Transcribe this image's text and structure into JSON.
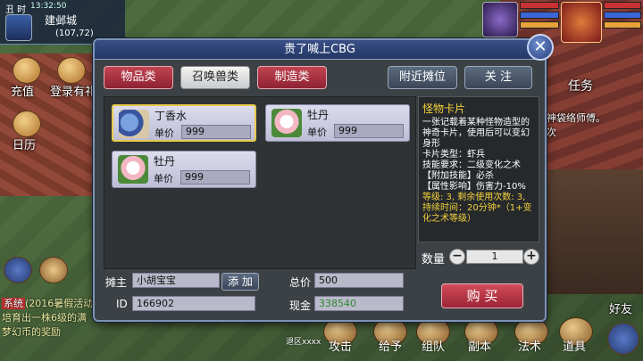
{
  "hud": {
    "time_prefix": "丑 时",
    "clock": "13:32:50",
    "map_name": "建邺城",
    "coords": "(107,72)",
    "side_left": [
      {
        "label": "充值",
        "icon": "coin-icon"
      },
      {
        "label": "登录有礼",
        "icon": "gift-icon"
      },
      {
        "label": "日历",
        "icon": "calendar-icon"
      }
    ],
    "right_task": "任务",
    "right_npc": "神袋络师傅。",
    "right_npc2": "次",
    "chat": [
      {
        "tag": "系统",
        "text": "(2016暑假活动"
      },
      {
        "text": "培育出一株6级的满"
      },
      {
        "text": "梦幻币的奖励"
      }
    ],
    "bottom_buttons": [
      "攻击",
      "给予",
      "组队",
      "副本",
      "法术",
      "道具"
    ],
    "friend": "好友",
    "ground_text": "退区xxxx"
  },
  "panel": {
    "title": "贵了喊上CBG",
    "close": "✕"
  },
  "tabs": [
    {
      "label": "物品类",
      "state": "active"
    },
    {
      "label": "召唤兽类",
      "state": "normal"
    },
    {
      "label": "制造类",
      "state": "red"
    }
  ],
  "top_buttons": {
    "nearby": "附近摊位",
    "follow": "关 注"
  },
  "items": [
    {
      "name": "丁香水",
      "price_label": "单价",
      "price": "999",
      "icon": "snail-potion-icon",
      "selected": true
    },
    {
      "name": "牡丹",
      "price_label": "单价",
      "price": "999",
      "icon": "peony-flower-icon",
      "selected": false
    },
    {
      "name": "牡丹",
      "price_label": "单价",
      "price": "999",
      "icon": "peony-flower-icon",
      "selected": false
    }
  ],
  "detail": {
    "title": "怪物卡片",
    "lines_white": [
      "一张记载着某种怪物造型的神奇卡片，使用后可以变幻身形",
      "卡片类型：虾兵",
      "技能要求：二级变化之术",
      "【附加技能】必杀",
      "【属性影响】伤害力-10%"
    ],
    "lines_yellow": [
      "等级: 3, 剩余使用次数: 3, 持续时间：20分钟*（1+变化之术等级）"
    ]
  },
  "quantity": {
    "label": "数量",
    "value": "1",
    "minus": "−",
    "plus": "+"
  },
  "buy_label": "购 买",
  "stall": {
    "owner_label": "摊主",
    "owner": "小胡宝宝",
    "add_label": "添 加",
    "id_label": "ID",
    "id": "166902",
    "total_label": "总价",
    "total": "500",
    "cash_label": "现金",
    "cash": "338540"
  },
  "colors": {
    "accent_red": "#c14452",
    "panel_border": "#7d93b6",
    "highlight_yellow": "#f4d23a",
    "cash_green": "#2e8a2e"
  }
}
